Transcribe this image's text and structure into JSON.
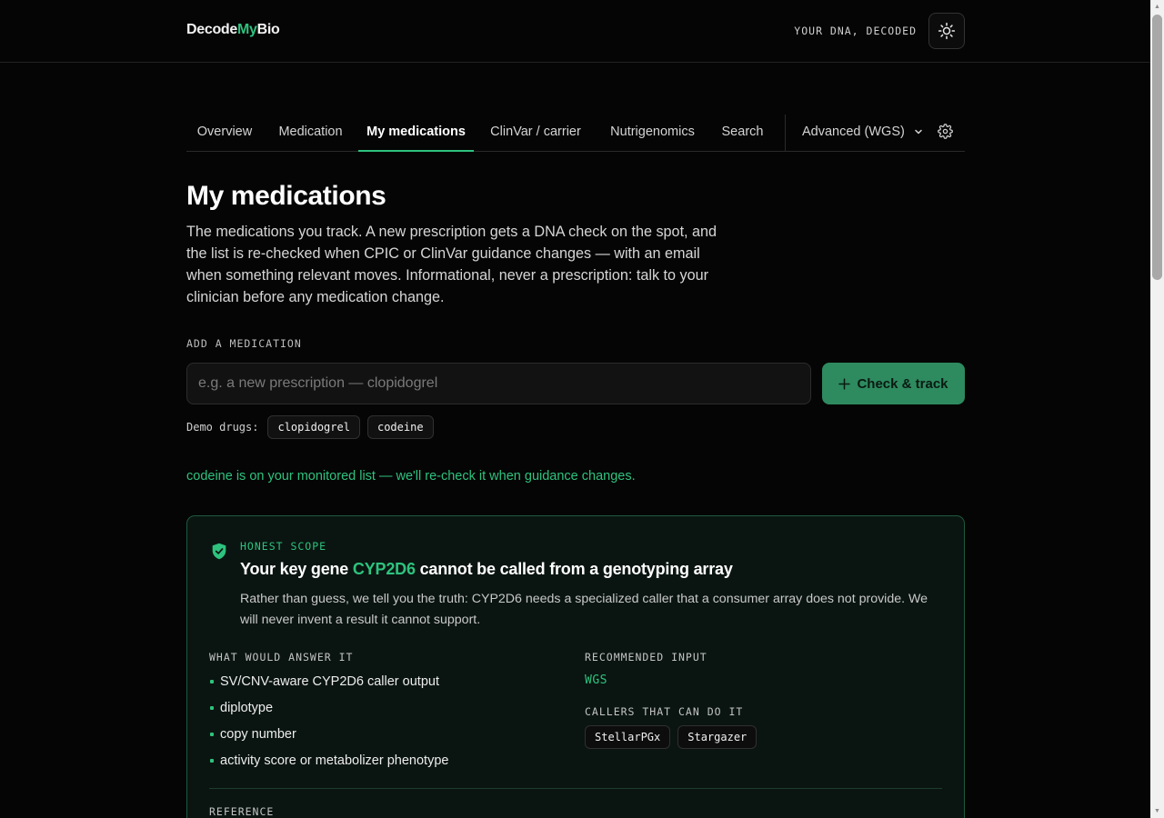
{
  "header": {
    "brand_part1": "Decode",
    "brand_part2": "My",
    "brand_part3": "Bio",
    "tagline": "YOUR DNA, DECODED",
    "theme_icon": "sun-icon"
  },
  "nav": {
    "tabs": [
      {
        "label": "Overview"
      },
      {
        "label": "Medication"
      },
      {
        "label": "My medications",
        "active": true
      },
      {
        "label": "ClinVar / carrier"
      },
      {
        "label": "Nutrigenomics"
      },
      {
        "label": "Search"
      }
    ],
    "mode_label": "Advanced (WGS)",
    "settings_icon": "gear-icon"
  },
  "main": {
    "title": "My medications",
    "intro": "The medications you track. A new prescription gets a DNA check on the spot, and the list is re-checked when CPIC or ClinVar guidance changes — with an email when something relevant moves. Informational, never a prescription: talk to your clinician before any medication change.",
    "add_label": "ADD A MEDICATION",
    "input_placeholder": "e.g. a new prescription — clopidogrel",
    "input_value": "",
    "add_button_label": "Check & track",
    "demo_label": "Demo drugs:",
    "demo_drugs": [
      "clopidogrel",
      "codeine"
    ],
    "status_message": "codeine is on your monitored list — we'll re-check it when guidance changes."
  },
  "scope_card": {
    "kicker": "HONEST SCOPE",
    "title_prefix": "Your key gene ",
    "gene": "CYP2D6",
    "title_suffix": " cannot be called from a genotyping array",
    "body": "Rather than guess, we tell you the truth: CYP2D6 needs a specialized caller that a consumer array does not provide. We will never invent a result it cannot support.",
    "answer_label": "WHAT WOULD ANSWER IT",
    "answer_items": [
      "SV/CNV-aware CYP2D6 caller output",
      "diplotype",
      "copy number",
      "activity score or metabolizer phenotype"
    ],
    "recommended_label": "RECOMMENDED INPUT",
    "recommended_value": "WGS",
    "callers_label": "CALLERS THAT CAN DO IT",
    "callers": [
      "StellarPGx",
      "Stargazer"
    ],
    "reference_label": "REFERENCE"
  },
  "colors": {
    "accent": "#2ec27e",
    "button": "#2e8a5f",
    "background": "#050505",
    "card_border": "#1d5a3e"
  }
}
